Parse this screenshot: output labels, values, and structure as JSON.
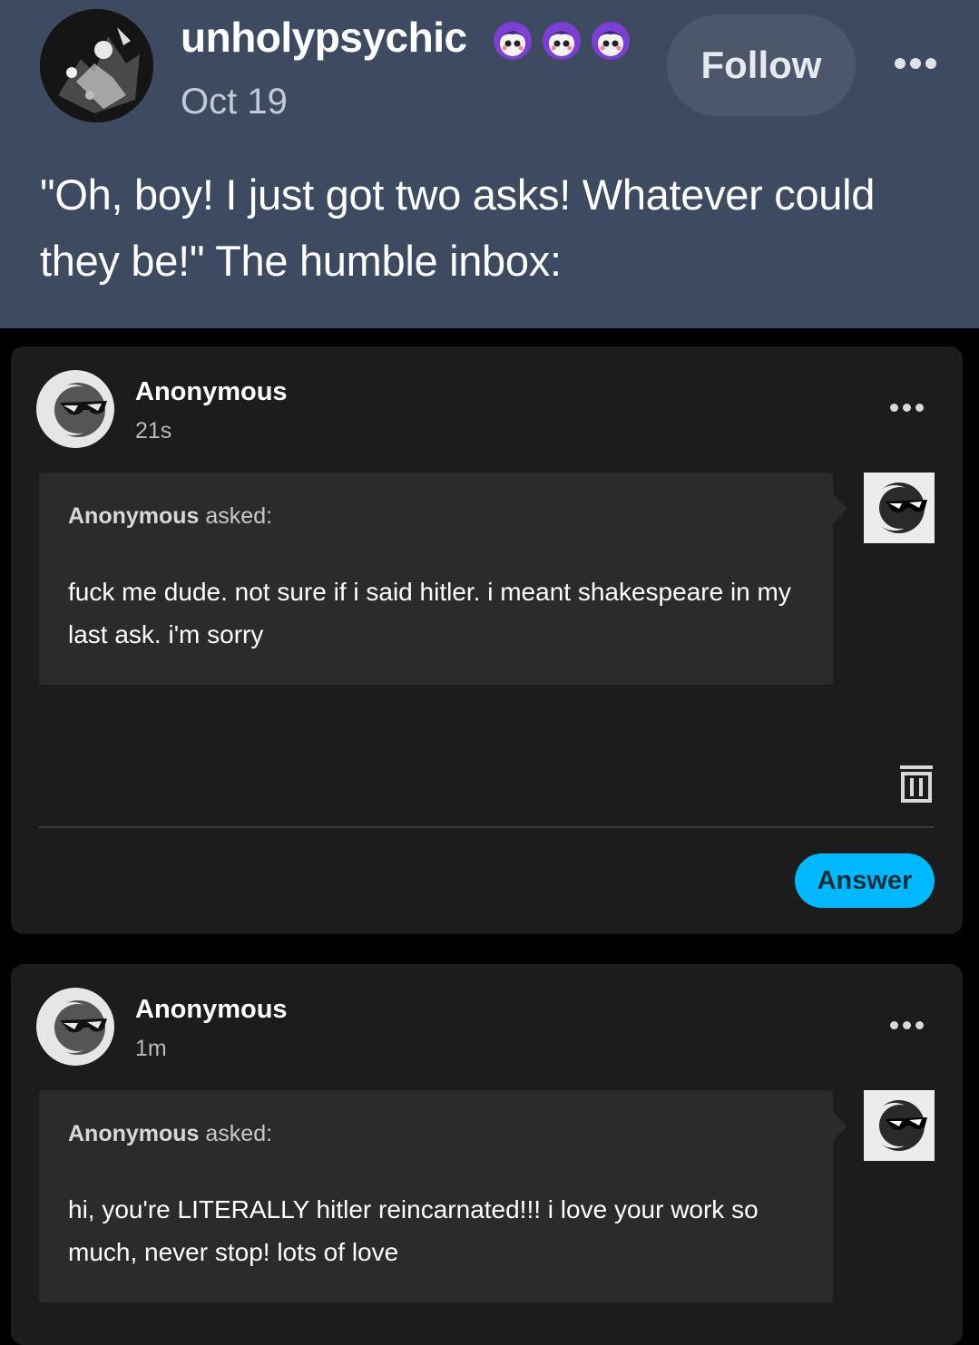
{
  "post": {
    "blog_name": "unholypsychic",
    "date": "Oct 19",
    "follow_label": "Follow",
    "text": "\"Oh, boy! I just got two asks! Whatever could they be!\" The humble inbox:",
    "badges": [
      "purple-face-badge-icon",
      "purple-face-badge-icon",
      "purple-face-badge-icon"
    ],
    "colors": {
      "header_bg": "#3e4a60",
      "follow_bg": "#4c576c",
      "badge_purple": "#7b3fd1"
    }
  },
  "asks": [
    {
      "asker": "Anonymous",
      "time": "21s",
      "asked_name": "Anonymous",
      "asked_suffix": " asked:",
      "body": "fuck me dude. not sure if i said hitler. i meant shakespeare in my last ask. i'm sorry",
      "answer_label": "Answer"
    },
    {
      "asker": "Anonymous",
      "time": "1m",
      "asked_name": "Anonymous",
      "asked_suffix": " asked:",
      "body": "hi, you're LITERALLY hitler reincarnated!!! i love your work so much, never stop! lots of love"
    }
  ],
  "colors": {
    "card_bg": "#1c1c1c",
    "bubble_bg": "#2b2b2b",
    "answer_accent": "#00b8ff"
  }
}
